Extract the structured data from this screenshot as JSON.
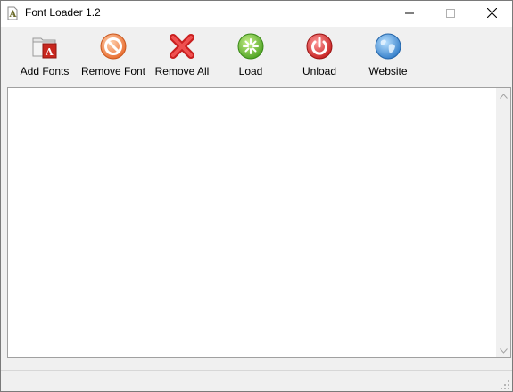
{
  "window": {
    "title": "Font Loader 1.2"
  },
  "caption_buttons": {
    "minimize_icon": "minimize-icon",
    "maximize_icon": "maximize-icon",
    "close_icon": "close-icon"
  },
  "toolbar": {
    "items": [
      {
        "label": "Add Fonts",
        "icon": "add-fonts-icon"
      },
      {
        "label": "Remove Font",
        "icon": "remove-font-icon"
      },
      {
        "label": "Remove All",
        "icon": "remove-all-icon"
      },
      {
        "label": "Load",
        "icon": "load-icon"
      },
      {
        "label": "Unload",
        "icon": "unload-icon"
      },
      {
        "label": "Website",
        "icon": "website-icon"
      }
    ]
  },
  "font_list": {
    "items": []
  },
  "colors": {
    "remove_orange": "#f07a3a",
    "remove_all_red": "#d93030",
    "load_green": "#5cb82a",
    "unload_red": "#d42a2a",
    "website_blue": "#3f8fd6"
  }
}
